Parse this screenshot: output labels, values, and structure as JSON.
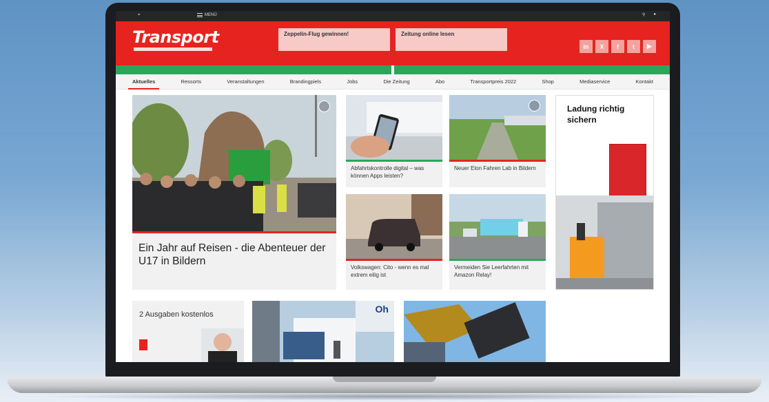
{
  "topbar": {
    "menu_label": "MENÜ"
  },
  "header": {
    "logo": "Transport",
    "promos": [
      {
        "title": "Zeppelin-Flug gewinnen!"
      },
      {
        "title": "Zeitung online lesen"
      }
    ],
    "social": [
      "in",
      "X",
      "f",
      "t",
      "▶"
    ]
  },
  "nav": {
    "items": [
      "Aktuelles",
      "Ressorts",
      "Veranstaltungen",
      "Brandingpiels",
      "Jobs",
      "Die Zeitung",
      "Abo",
      "Transportpreis 2022",
      "Shop",
      "Mediaservice",
      "Kontakt"
    ],
    "active_index": 0
  },
  "main": {
    "hero": {
      "title": "Ein Jahr auf Reisen - die Abenteuer der U17 in Bildern"
    },
    "cards": [
      {
        "title": "Abfahrtskontrolle digital – was können Apps leisten?"
      },
      {
        "title": "Neuer Elon Fahren Lab in Bildern"
      },
      {
        "title": "Volkswagen: Cito - wenn es mal extrem eilig ist"
      },
      {
        "title": "Vermeiden Sie Leerfahrten mit Amazon Relay!"
      }
    ],
    "ad": {
      "title": "Ladung richtig sichern"
    },
    "subscribe": {
      "title": "2 Ausgaben kostenlos"
    },
    "bottom_logo": "Oh"
  },
  "colors": {
    "brand": "#e6231e",
    "accent_green": "#2aa55b"
  }
}
